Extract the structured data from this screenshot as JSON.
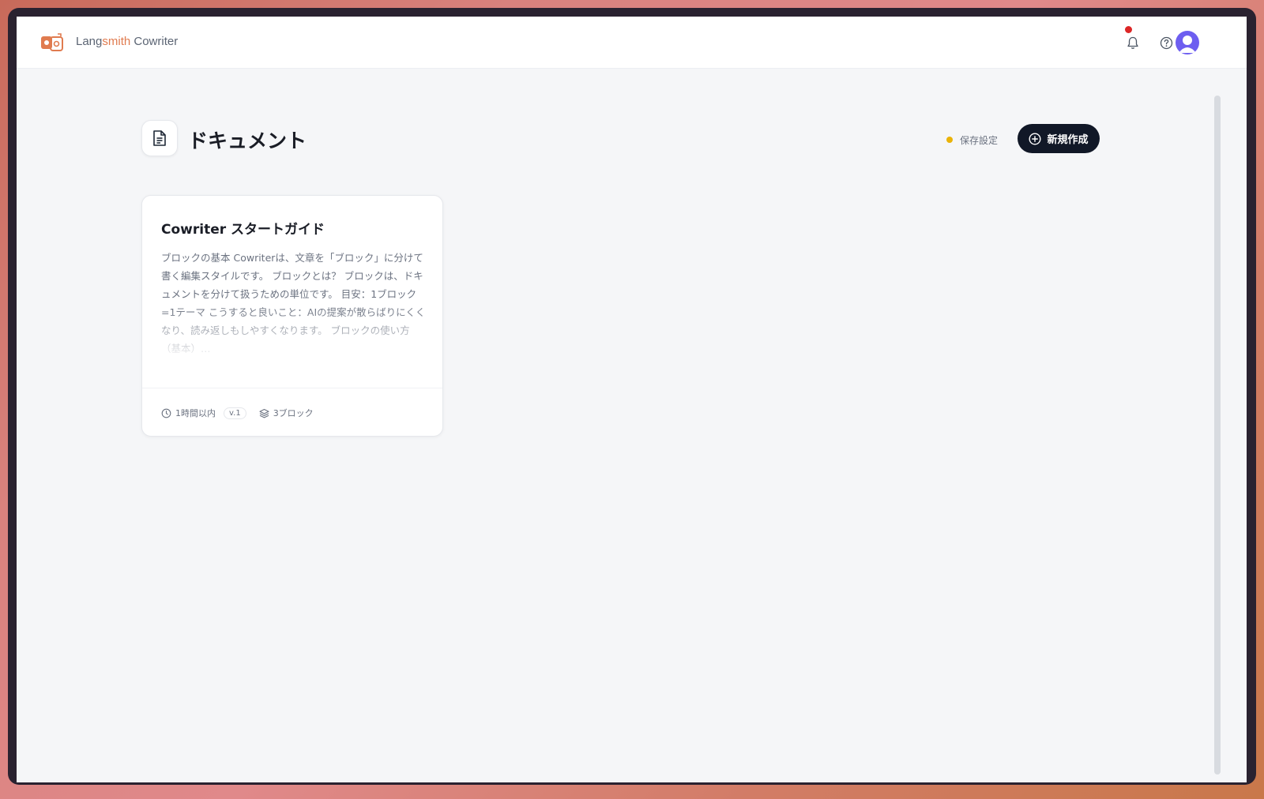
{
  "brand": {
    "prefix": "Lang",
    "accent": "smith",
    "suffix": " Cowriter"
  },
  "header_icons": [
    "bell-icon",
    "help-icon",
    "user-avatar"
  ],
  "page": {
    "title": "ドキュメント",
    "save_settings_label": "保存設定",
    "new_button_label": "新規作成"
  },
  "documents": [
    {
      "title": "Cowriter スタートガイド",
      "excerpt": "ブロックの基本 Cowriterは、文章を「ブロック」に分けて書く編集スタイルです。 ブロックとは？ ブロックは、ドキュメントを分けて扱うための単位です。 目安：1ブロック=1テーマ こうすると良いこと：AIの提案が散らばりにくくなり、読み返しもしやすくなります。 ブロックの使い方（基本）…",
      "updated": "1時間以内",
      "version": "v.1",
      "blocks": "3ブロック"
    }
  ],
  "colors": {
    "accent": "#e07b4f",
    "primary_button": "#111827",
    "status_dot": "#eab308",
    "notification": "#dc2626",
    "avatar": "#6d5ef0"
  }
}
